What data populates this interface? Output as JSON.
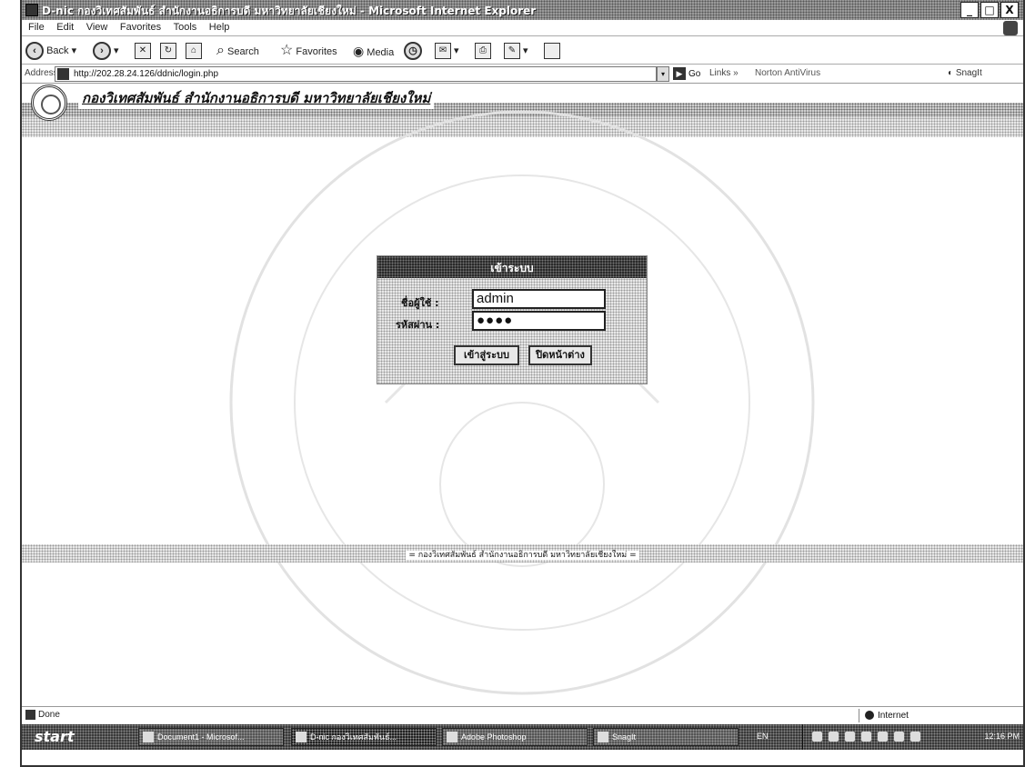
{
  "window": {
    "title": "D-nic กองวิเทศสัมพันธ์ สำนักงานอธิการบดี มหาวิทยาลัยเชียงใหม่ - Microsoft Internet Explorer",
    "controls": {
      "minimize": "_",
      "maximize": "□",
      "close": "X"
    }
  },
  "menu": [
    "File",
    "Edit",
    "View",
    "Favorites",
    "Tools",
    "Help"
  ],
  "toolbar": {
    "back": "Back",
    "search": "Search",
    "favorites": "Favorites",
    "media": "Media"
  },
  "address": {
    "label": "Address",
    "url": "http://202.28.24.126/ddnic/login.php",
    "go": "Go",
    "links": "Links",
    "norton": "Norton AntiVirus",
    "snagit": "SnagIt"
  },
  "site": {
    "title": "กองวิเทศสัมพันธ์ สำนักงานอธิการบดี มหาวิทยาลัยเชียงใหม่",
    "footer": "= กองวิเทศสัมพันธ์ สำนักงานอธิการบดี มหาวิทยาลัยเชียงใหม่ ="
  },
  "login": {
    "title": "เข้าระบบ",
    "username_label": "ชื่อผู้ใช้ :",
    "password_label": "รหัสผ่าน :",
    "username_value": "admin",
    "password_value": "●●●●",
    "submit": "เข้าสู่ระบบ",
    "close": "ปิดหน้าต่าง"
  },
  "status": {
    "text": "Done",
    "zone": "Internet"
  },
  "taskbar": {
    "start": "start",
    "tasks": [
      "Document1 - Microsof...",
      "D-nic กองวิเทศสัมพันธ์...",
      "Adobe Photoshop",
      "SnagIt"
    ],
    "lang": "EN",
    "clock": "12:16 PM"
  }
}
